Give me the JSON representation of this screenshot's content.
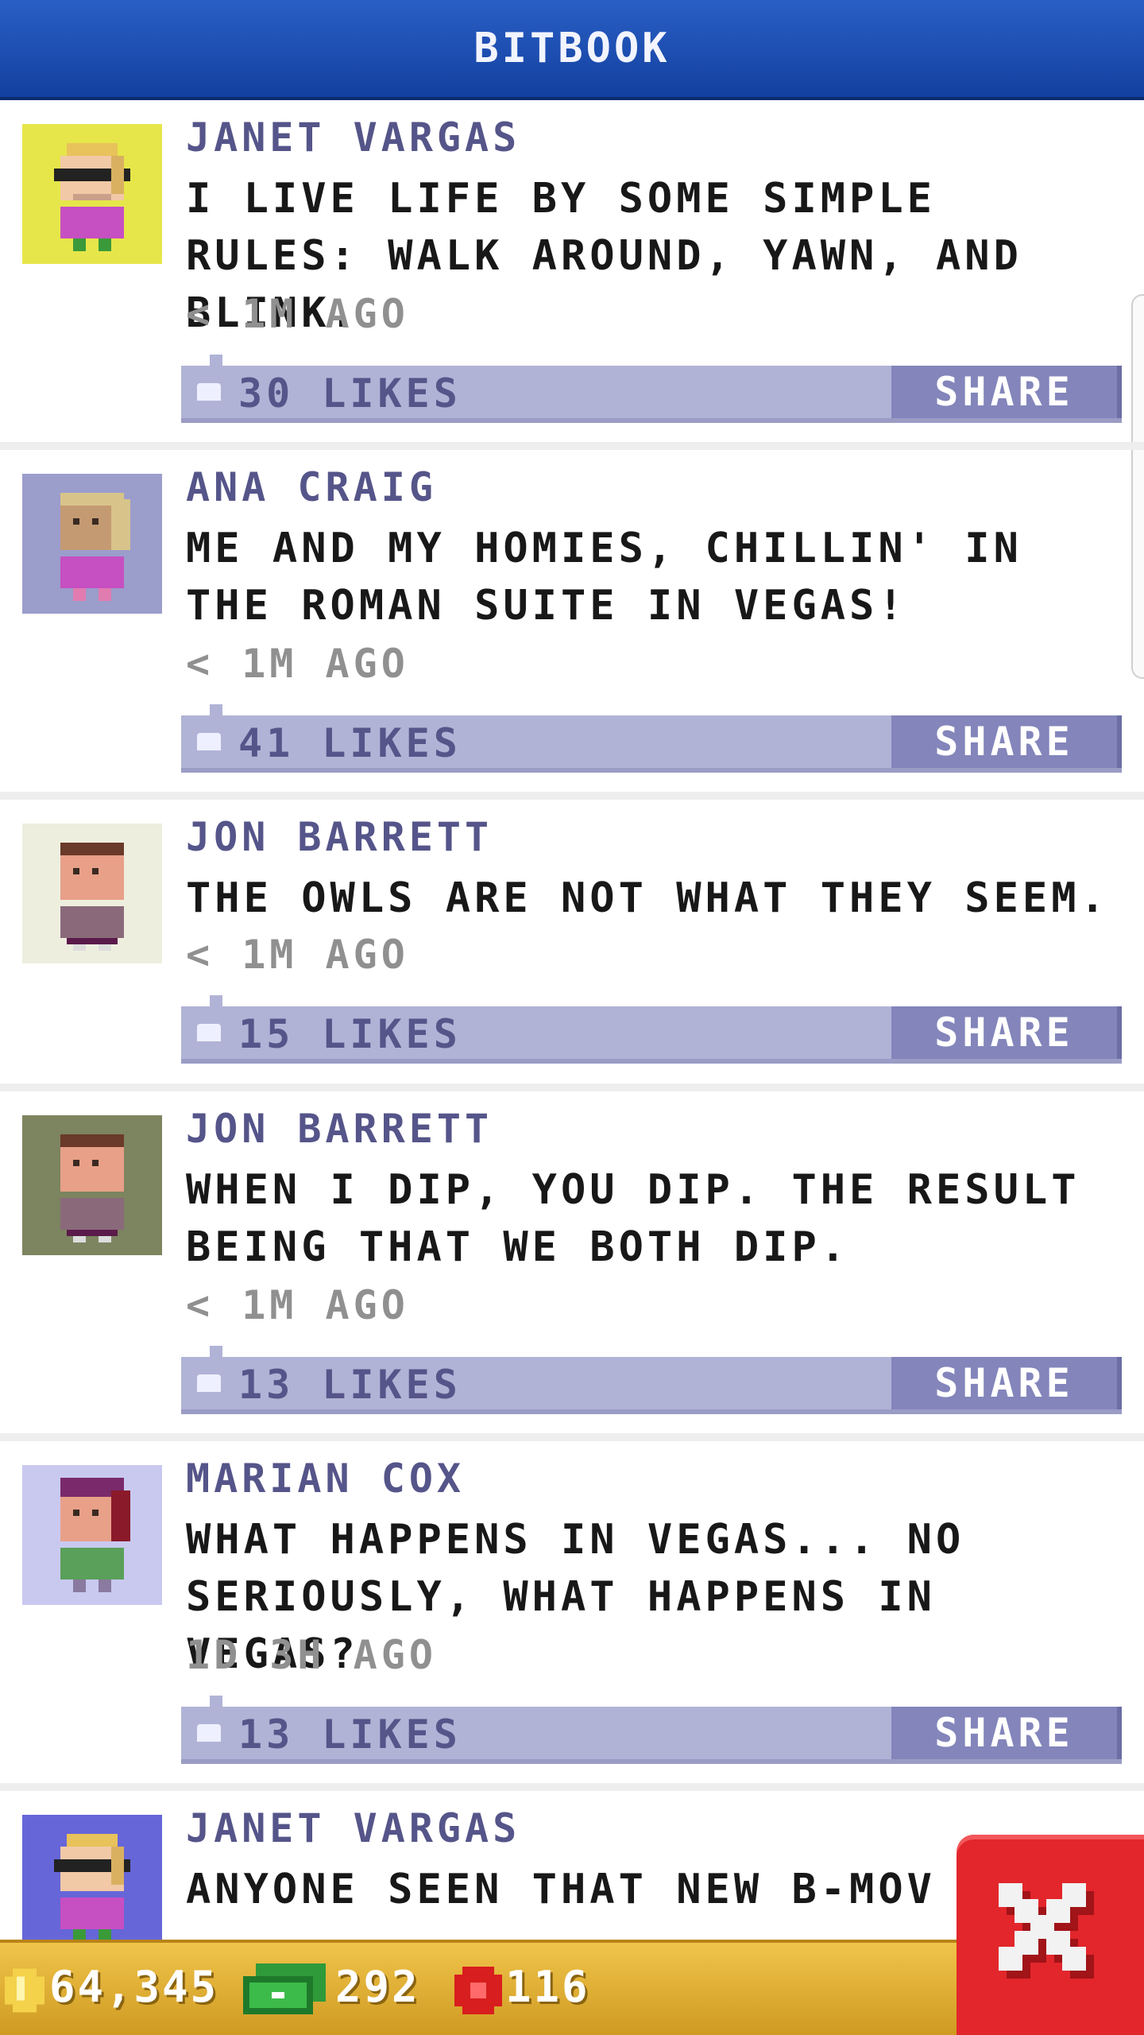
{
  "header": {
    "title": "BITBOOK"
  },
  "posts": [
    {
      "name": "JANET VARGAS",
      "message": "I LIVE LIFE BY SOME SIMPLE RULES: WALK AROUND, YAWN, AND BLINK.",
      "time": "< 1M AGO",
      "likes": "30 LIKES",
      "share": "SHARE",
      "avatar_bg": "#e6e64a"
    },
    {
      "name": "ANA CRAIG",
      "message": "ME AND MY HOMIES, CHILLIN' IN THE ROMAN SUITE IN VEGAS!",
      "time": "< 1M AGO",
      "likes": "41 LIKES",
      "share": "SHARE",
      "avatar_bg": "#9b9dcb"
    },
    {
      "name": "JON BARRETT",
      "message": "THE OWLS ARE NOT WHAT THEY SEEM.",
      "time": "< 1M AGO",
      "likes": "15 LIKES",
      "share": "SHARE",
      "avatar_bg": "#eeeedf"
    },
    {
      "name": "JON BARRETT",
      "message": "WHEN I DIP, YOU DIP. THE RESULT BEING THAT WE BOTH DIP.",
      "time": "< 1M AGO",
      "likes": "13 LIKES",
      "share": "SHARE",
      "avatar_bg": "#7d8460"
    },
    {
      "name": "MARIAN COX",
      "message": "WHAT HAPPENS IN VEGAS... NO SERIOUSLY, WHAT HAPPENS IN VEGAS?",
      "time": "1D 3H AGO",
      "likes": "13 LIKES",
      "share": "SHARE",
      "avatar_bg": "#c9c9f0"
    },
    {
      "name": "JANET VARGAS",
      "message": "ANYONE SEEN THAT NEW B-MOV",
      "time": "",
      "likes": "",
      "share": "",
      "avatar_bg": "#6666d8"
    }
  ],
  "footer": {
    "coins": "64,345",
    "bux": "292",
    "tokens": "116"
  },
  "icons": [
    "thumb-up-icon",
    "coin-icon",
    "bux-icon",
    "token-icon",
    "close-icon"
  ],
  "colors": {
    "header": "#1a4fb5",
    "footer": "#e3b13a",
    "like_bar": "#b1b3d6",
    "share_button": "#8385bb",
    "close_button": "#e2262b"
  }
}
